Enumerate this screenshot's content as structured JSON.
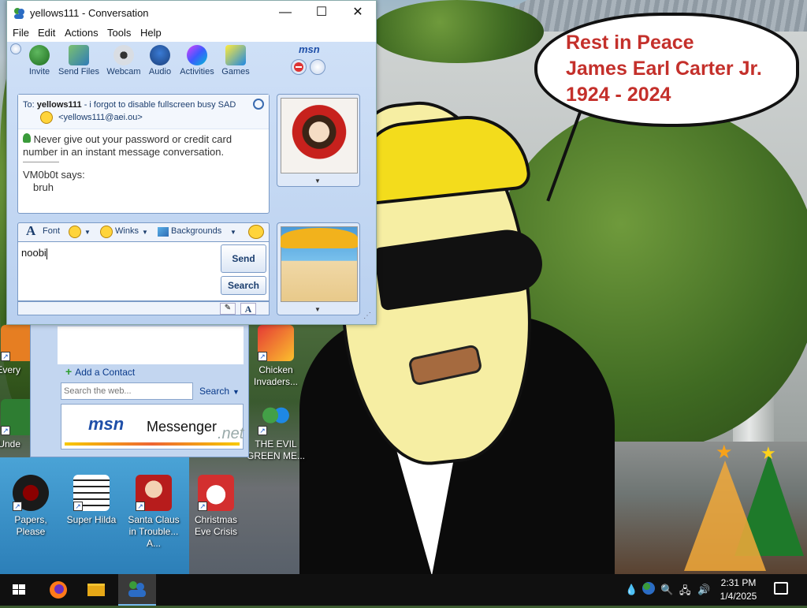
{
  "window": {
    "title": "yellows111 - Conversation",
    "minimize_glyph": "—",
    "maximize_glyph": "☐",
    "close_glyph": "✕"
  },
  "menu": [
    "File",
    "Edit",
    "Actions",
    "Tools",
    "Help"
  ],
  "toolbar": {
    "items": [
      {
        "label": "Invite",
        "icon": "invite-icon"
      },
      {
        "label": "Send Files",
        "icon": "send-files-icon"
      },
      {
        "label": "Webcam",
        "icon": "webcam-icon"
      },
      {
        "label": "Audio",
        "icon": "audio-icon"
      },
      {
        "label": "Activities",
        "icon": "activities-icon"
      },
      {
        "label": "Games",
        "icon": "games-icon"
      }
    ],
    "logo": "msn"
  },
  "conversation": {
    "to_label": "To:",
    "contact_name": "yellows111",
    "contact_status": "- i forgot to disable fullscreen busy SAD",
    "contact_email": "<yellows111@aei.ou>",
    "warning": "Never give out your password or credit card number in an instant message conversation.",
    "sender": "VM0b0t says:",
    "message": "bruh"
  },
  "format_bar": {
    "font": "Font",
    "winks": "Winks",
    "backgrounds": "Backgrounds"
  },
  "input": {
    "value": "noobi"
  },
  "buttons": {
    "send": "Send",
    "search": "Search"
  },
  "main_window": {
    "add_contact": "Add a Contact",
    "web_search_placeholder": "Search the web...",
    "search_label": "Search",
    "banner_msn": "msn",
    "banner_messenger": "Messenger",
    "banner_net": ".net"
  },
  "bubble": {
    "line1": "Rest in Peace",
    "line2": "James Earl Carter Jr.",
    "line3": "1924 - 2024"
  },
  "desktop_icons": [
    {
      "label": "Every"
    },
    {
      "label": "Unde"
    },
    {
      "label": "Papers, Please"
    },
    {
      "label": "Super Hilda"
    },
    {
      "label": "Santa Claus in Trouble... A..."
    },
    {
      "label": "Christmas Eve Crisis"
    },
    {
      "label": "Chicken Invaders..."
    },
    {
      "label": "THE EVIL GREEN ME..."
    }
  ],
  "taskbar": {
    "time": "2:31 PM",
    "date": "1/4/2025"
  },
  "colors": {
    "bubble_text": "#c4302b",
    "msn_blue": "#1f4fa8",
    "taskbar": "#101010"
  }
}
